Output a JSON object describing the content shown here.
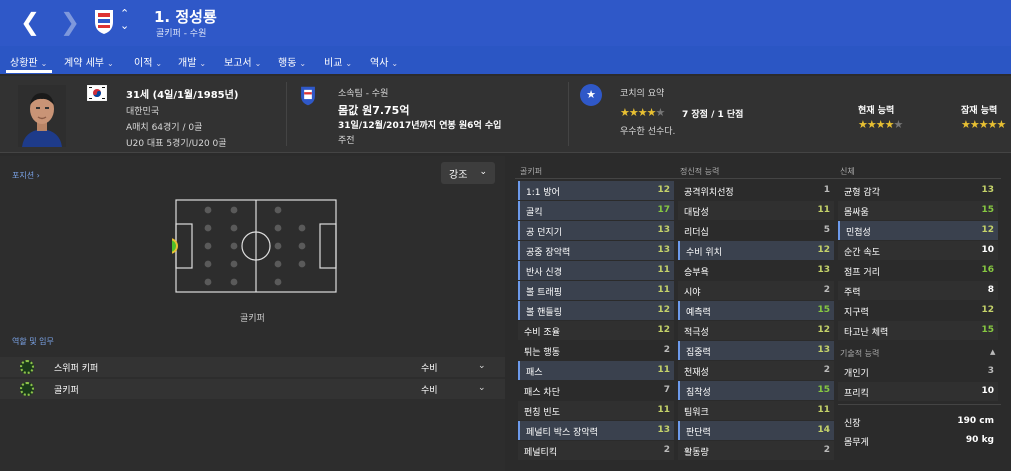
{
  "title": {
    "name": "1. 정성룡",
    "subtitle": "골키퍼 - 수원"
  },
  "tabs": [
    {
      "label": "상황판",
      "chev": true
    },
    {
      "label": "계약 세부",
      "chev": true
    },
    {
      "label": "이적",
      "chev": true
    },
    {
      "label": "개발",
      "chev": true
    },
    {
      "label": "보고서",
      "chev": true
    },
    {
      "label": "행동",
      "chev": true
    },
    {
      "label": "비교",
      "chev": true
    },
    {
      "label": "역사",
      "chev": true
    }
  ],
  "profile": {
    "age": "31세 (4일/1월/1985년)",
    "nation": "대한민국",
    "caps": "A매치 64경기 / 0골",
    "u20": "U20 대표 5경기/U20 0골"
  },
  "club": {
    "team": "소속팀 - 수원",
    "value": "몸값 원7.75억",
    "contract": "31일/12월/2017년까지 연봉 원6억 수입",
    "status": "주전"
  },
  "coach": {
    "title": "코치의 요약",
    "strengths": "7 장점 / 1 단점",
    "summary": "우수한 선수다.",
    "rating_stars": 3.5,
    "current_label": "현재 능력",
    "current_stars": 3.5,
    "potential_label": "잠재 능력",
    "potential_stars": 4.5
  },
  "left": {
    "position_link": "포지션",
    "emphasis": "강조",
    "position_label": "골키퍼",
    "roles_link": "역할 및 임무",
    "roles": [
      {
        "name": "스위퍼 키퍼",
        "duty": "수비"
      },
      {
        "name": "골키퍼",
        "duty": "수비"
      }
    ]
  },
  "colors": {
    "accent": "#2f58c8",
    "high": "#86c741",
    "mid": "#c5d36a",
    "star": "#e8c032"
  },
  "goalkeeping": {
    "title": "골키퍼",
    "rows": [
      {
        "n": "1:1 방어",
        "v": "12",
        "hl": true
      },
      {
        "n": "골킥",
        "v": "17",
        "hl": true
      },
      {
        "n": "공 던지기",
        "v": "13",
        "hl": true
      },
      {
        "n": "공중 장악력",
        "v": "13",
        "hl": true
      },
      {
        "n": "반사 신경",
        "v": "11",
        "hl": true
      },
      {
        "n": "볼 트래핑",
        "v": "11",
        "hl": true
      },
      {
        "n": "볼 핸들링",
        "v": "12",
        "hl": true
      },
      {
        "n": "수비 조율",
        "v": "12",
        "hl": false
      },
      {
        "n": "튀는 행동",
        "v": "2",
        "hl": false
      },
      {
        "n": "패스",
        "v": "11",
        "hl": true
      },
      {
        "n": "패스 차단",
        "v": "7",
        "hl": false
      },
      {
        "n": "펀칭 빈도",
        "v": "11",
        "hl": false
      },
      {
        "n": "페널티 박스 장악력",
        "v": "13",
        "hl": true
      },
      {
        "n": "페널티킥",
        "v": "2",
        "hl": false
      }
    ]
  },
  "mental": {
    "title": "정신적 능력",
    "rows": [
      {
        "n": "공격위치선정",
        "v": "1",
        "hl": false
      },
      {
        "n": "대담성",
        "v": "11",
        "hl": false
      },
      {
        "n": "리더십",
        "v": "5",
        "hl": false
      },
      {
        "n": "수비 위치",
        "v": "12",
        "hl": true
      },
      {
        "n": "승부욕",
        "v": "13",
        "hl": false
      },
      {
        "n": "시야",
        "v": "2",
        "hl": false
      },
      {
        "n": "예측력",
        "v": "15",
        "hl": true
      },
      {
        "n": "적극성",
        "v": "12",
        "hl": false
      },
      {
        "n": "집중력",
        "v": "13",
        "hl": true
      },
      {
        "n": "천재성",
        "v": "2",
        "hl": false
      },
      {
        "n": "침착성",
        "v": "15",
        "hl": true
      },
      {
        "n": "팀워크",
        "v": "11",
        "hl": false
      },
      {
        "n": "판단력",
        "v": "14",
        "hl": true
      },
      {
        "n": "활동량",
        "v": "2",
        "hl": false
      }
    ]
  },
  "physical": {
    "title": "신체",
    "rows": [
      {
        "n": "균형 감각",
        "v": "13",
        "hl": false
      },
      {
        "n": "몸싸움",
        "v": "15",
        "hl": false
      },
      {
        "n": "민첩성",
        "v": "12",
        "hl": true
      },
      {
        "n": "순간 속도",
        "v": "10",
        "hl": false
      },
      {
        "n": "점프 거리",
        "v": "16",
        "hl": false
      },
      {
        "n": "주력",
        "v": "8",
        "hl": false
      },
      {
        "n": "지구력",
        "v": "12",
        "hl": false
      },
      {
        "n": "타고난 체력",
        "v": "15",
        "hl": false
      }
    ]
  },
  "technical": {
    "title": "기술적 능력",
    "rows": [
      {
        "n": "개인기",
        "v": "3",
        "hl": false
      },
      {
        "n": "프리킥",
        "v": "10",
        "hl": false
      }
    ]
  },
  "body": {
    "height_label": "신장",
    "height": "190 cm",
    "weight_label": "몸무게",
    "weight": "90 kg"
  }
}
